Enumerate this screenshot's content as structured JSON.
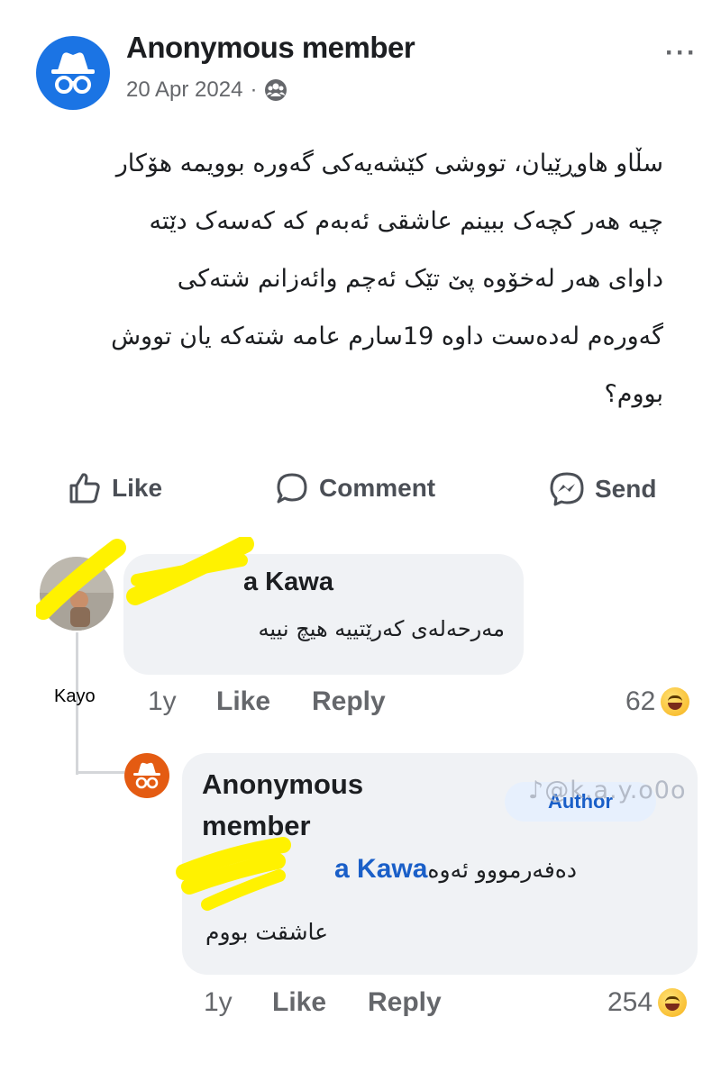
{
  "post": {
    "author": "Anonymous member",
    "date": "20 Apr 2024",
    "separator": "·",
    "more": "···",
    "body_lines": [
      "سڵاو هاوڕێیان، تووشی کێشەیەکی گەورە بوویمە هۆکار",
      "چیە هەر کچەک ببینم عاشقی ئەبەم کە کەسەک دێتە",
      "داوای هەر لەخۆوە پێ تێک ئەچم وائەزانم شتەکی",
      "گەورەم لەدەست داوە 19سارم عامە شتەکە یان تووش",
      "بووم؟"
    ]
  },
  "actions": {
    "like": "Like",
    "comment": "Comment",
    "send": "Send"
  },
  "comments": [
    {
      "name": "a Kawa",
      "text": "مەرحەلەی کەرێتییە هیچ نییە",
      "caption": "Kayo",
      "time": "1y",
      "like": "Like",
      "reply": "Reply",
      "reactions": "62"
    }
  ],
  "reply": {
    "name": "Anonymous member",
    "badge": "Author",
    "watermark": "♪@k.a.y.o0o",
    "mention": "a Kawa",
    "line1": "دەفەرمووو ئەوە",
    "line2": "عاشقت بووم",
    "time": "1y",
    "like": "Like",
    "reply": "Reply",
    "reactions": "254"
  },
  "colors": {
    "facebook_blue": "#1b74e4",
    "anon_avatar_orange": "#e45b12",
    "highlighter_yellow": "#fff200"
  },
  "icons": [
    "incognito-icon",
    "group-icon",
    "thumbs-up-icon",
    "comment-bubble-icon",
    "messenger-icon",
    "haha-reaction-icon"
  ]
}
